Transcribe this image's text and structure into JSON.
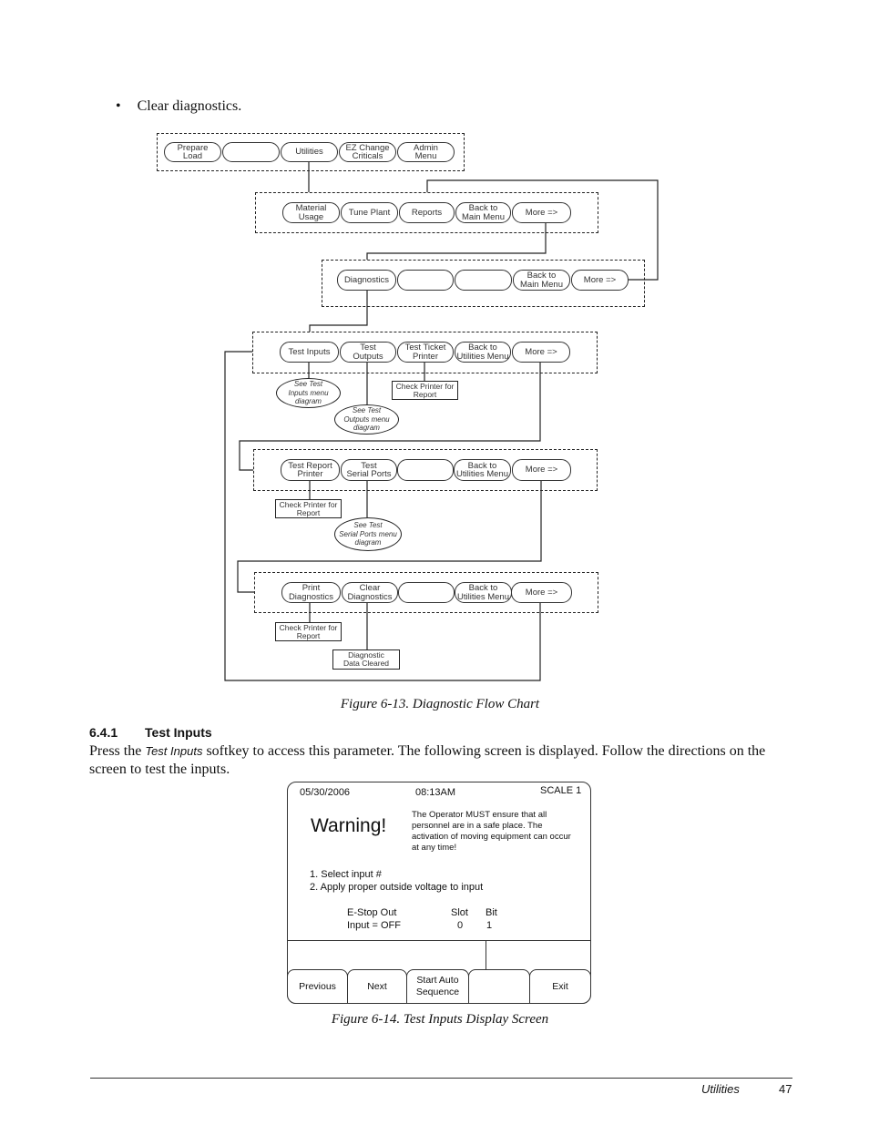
{
  "bullet": {
    "symbol": "•",
    "text": "Clear diagnostics."
  },
  "flowchart": {
    "main_menu": [
      "Prepare\nLoad",
      "",
      "Utilities",
      "EZ Change\nCriticals",
      "Admin\nMenu"
    ],
    "utilities_menu_1": [
      "Material\nUsage",
      "Tune Plant",
      "Reports",
      "Back to\nMain Menu",
      "More =>"
    ],
    "utilities_menu_2": [
      "Diagnostics",
      "",
      "",
      "Back to\nMain Menu",
      "More =>"
    ],
    "diagnostics_menu_1": [
      "Test Inputs",
      "Test\nOutputs",
      "Test Ticket\nPrinter",
      "Back to\nUtilities Menu",
      "More =>"
    ],
    "diagnostics_menu_2": [
      "Test Report\nPrinter",
      "Test\nSerial Ports",
      "",
      "Back to\nUtilities Menu",
      "More =>"
    ],
    "diagnostics_menu_3": [
      "Print\nDiagnostics",
      "Clear\nDiagnostics",
      "",
      "Back to\nUtilities Menu",
      "More =>"
    ],
    "notes": {
      "see_test_inputs": "See Test\nInputs menu\ndiagram",
      "see_test_outputs": "See Test\nOutputs menu\ndiagram",
      "check_printer_ticket": "Check Printer for\nReport",
      "check_printer_report": "Check Printer for\nReport",
      "see_serial_ports": "See Test\nSerial Ports menu\ndiagram",
      "check_printer_diag": "Check Printer for\nReport",
      "diag_cleared": "Diagnostic\nData Cleared"
    }
  },
  "figure_13_caption": "Figure 6-13. Diagnostic Flow Chart",
  "section": {
    "number": "6.4.1",
    "title": "Test Inputs"
  },
  "paragraph": {
    "before": "Press the ",
    "softkey": "Test Inputs",
    "after": " softkey to access this parameter. The following screen is displayed. Follow the directions on the screen to test the inputs."
  },
  "screen": {
    "date": "05/30/2006",
    "time": "08:13AM",
    "scale": "SCALE 1",
    "warning_title": "Warning!",
    "warning_text": "The Operator MUST ensure that all personnel are in a safe place. The activation of moving equipment can occur at any time!",
    "step1": "1. Select input #",
    "step2": "2. Apply proper outside voltage to input",
    "input_name": "E-Stop Out",
    "input_state": "Input = OFF",
    "slot_label": "Slot",
    "slot_value": "0",
    "bit_label": "Bit",
    "bit_value": "1",
    "softkeys": [
      "Previous",
      "Next",
      "Start Auto\nSequence",
      "",
      "Exit"
    ]
  },
  "figure_14_caption": "Figure 6-14. Test Inputs Display Screen",
  "footer": {
    "section": "Utilities",
    "page": "47"
  }
}
